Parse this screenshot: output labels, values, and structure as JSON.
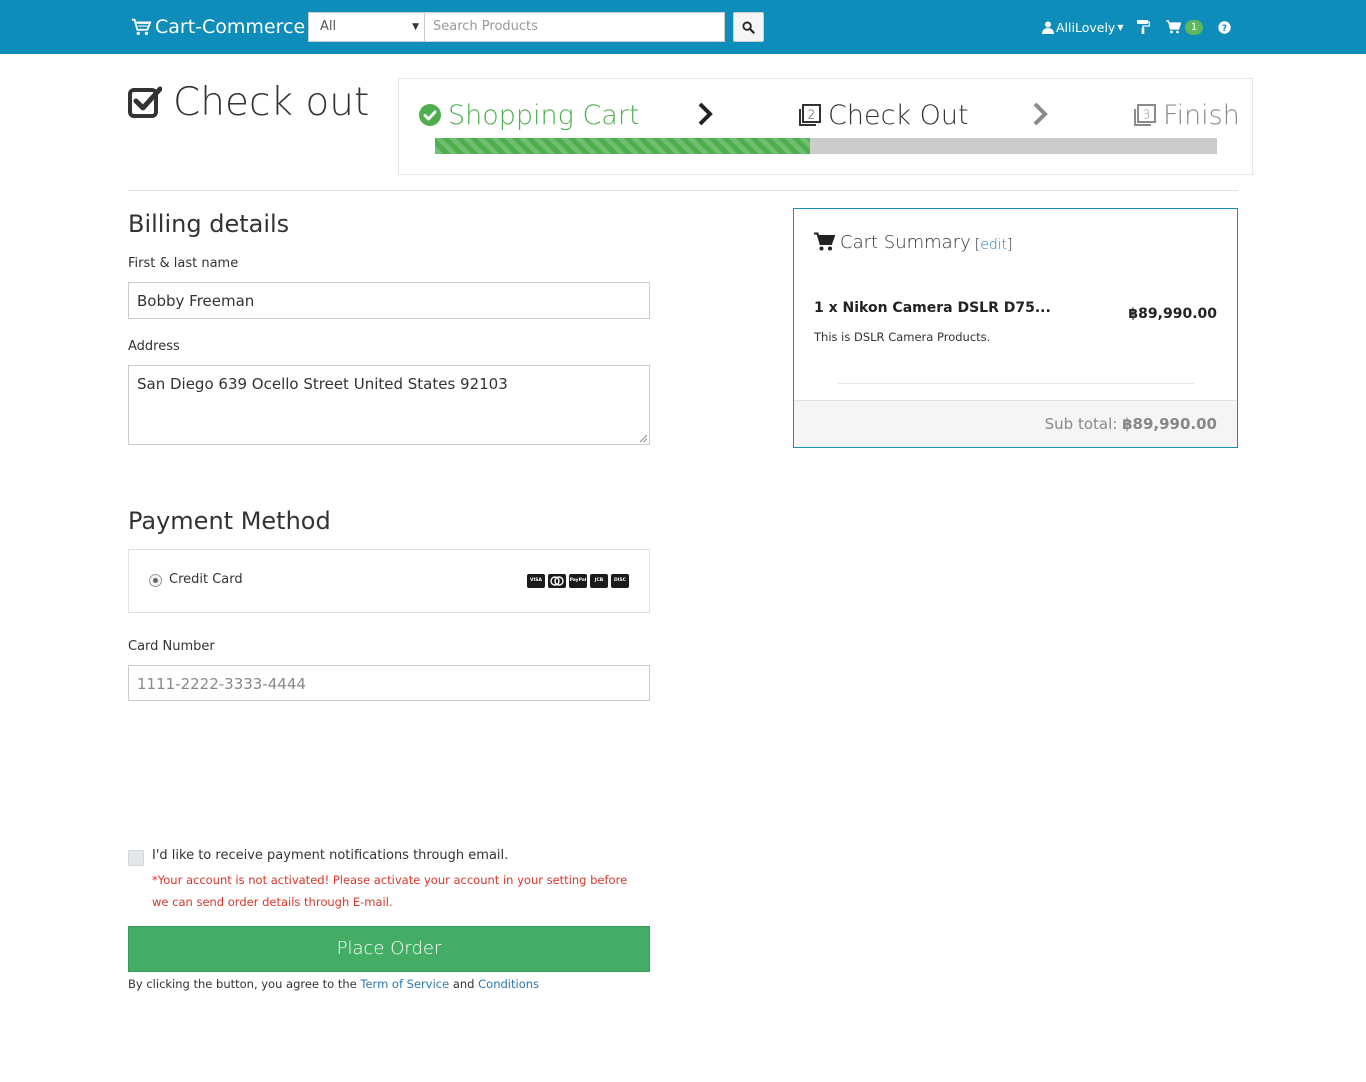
{
  "navbar": {
    "brand": "Cart-Commerce",
    "category_selected": "All",
    "search_placeholder": "Search Products",
    "username": "AlliLovely",
    "cart_count": "1",
    "color": "#0e8cba"
  },
  "header": {
    "title": "Check out",
    "steps": [
      {
        "label": "Shopping Cart",
        "status": "done"
      },
      {
        "label": "Check Out",
        "status": "current"
      },
      {
        "label": "Finish",
        "status": "pending"
      }
    ],
    "progress_fraction": 0.48
  },
  "billing": {
    "title": "Billing details",
    "name_label": "First & last name",
    "name_value": "Bobby Freeman",
    "address_label": "Address",
    "address_value": "San Diego 639 Ocello Street United States 92103"
  },
  "payment": {
    "title": "Payment Method",
    "option_label": "Credit Card",
    "card_brands": [
      "VISA",
      "MC",
      "PayPal",
      "JCB",
      "DISC"
    ],
    "card_number_label": "Card Number",
    "card_number_placeholder": "1111-2222-3333-4444"
  },
  "notify": {
    "checkbox_label": "I'd like to receive payment notifications through email.",
    "warning": "*Your account is not activated! Please activate your account in your setting before we can send order details through E-mail."
  },
  "order": {
    "button_label": "Place Order",
    "agree_prefix": "By clicking the button, you agree to the",
    "terms_link": "Term of Service",
    "and_text": "and",
    "conditions_link": "Conditions",
    "button_color": "#43ad66"
  },
  "summary": {
    "title": "Cart Summary",
    "edit_open": "[",
    "edit_link": "edit",
    "edit_close": "]",
    "item_name": "1 x Nikon Camera DSLR D75...",
    "item_description": "This is DSLR Camera Products.",
    "item_price": "฿89,990.00",
    "subtotal_label": "Sub total:",
    "subtotal_value": "฿89,990.00"
  }
}
